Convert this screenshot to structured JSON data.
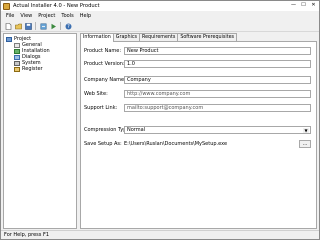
{
  "window": {
    "title": "Actual Installer 4.0 - New Product",
    "minimize": "—",
    "maximize": "☐",
    "close": "✕"
  },
  "menu": [
    "File",
    "View",
    "Project",
    "Tools",
    "Help"
  ],
  "toolbar": {
    "icons": [
      "new-icon",
      "open-icon",
      "save-icon",
      "build-icon",
      "run-icon",
      "help-icon"
    ]
  },
  "tree": {
    "root": "Project",
    "children": [
      "General",
      "Installation",
      "Dialogs",
      "System",
      "Register"
    ]
  },
  "tabs": [
    "Information",
    "Graphics",
    "Requirements",
    "Software Prerequisites"
  ],
  "form": {
    "product_name": {
      "label": "Product Name:",
      "value": "New Product"
    },
    "product_version": {
      "label": "Product Version:",
      "value": "1.0"
    },
    "company_name": {
      "label": "Company Name:",
      "value": "Company"
    },
    "web_site": {
      "label": "Web Site:",
      "value": "http://www.company.com"
    },
    "support_link": {
      "label": "Support Link:",
      "value": "mailto:support@company.com"
    },
    "compression_type": {
      "label": "Compression Type:",
      "value": "Normal"
    },
    "save_setup_as": {
      "label": "Save Setup As:",
      "value": "E:\\Users\\Ruslan\\Documents\\MySetup.exe",
      "browse": "..."
    }
  },
  "status": "For Help, press F1"
}
